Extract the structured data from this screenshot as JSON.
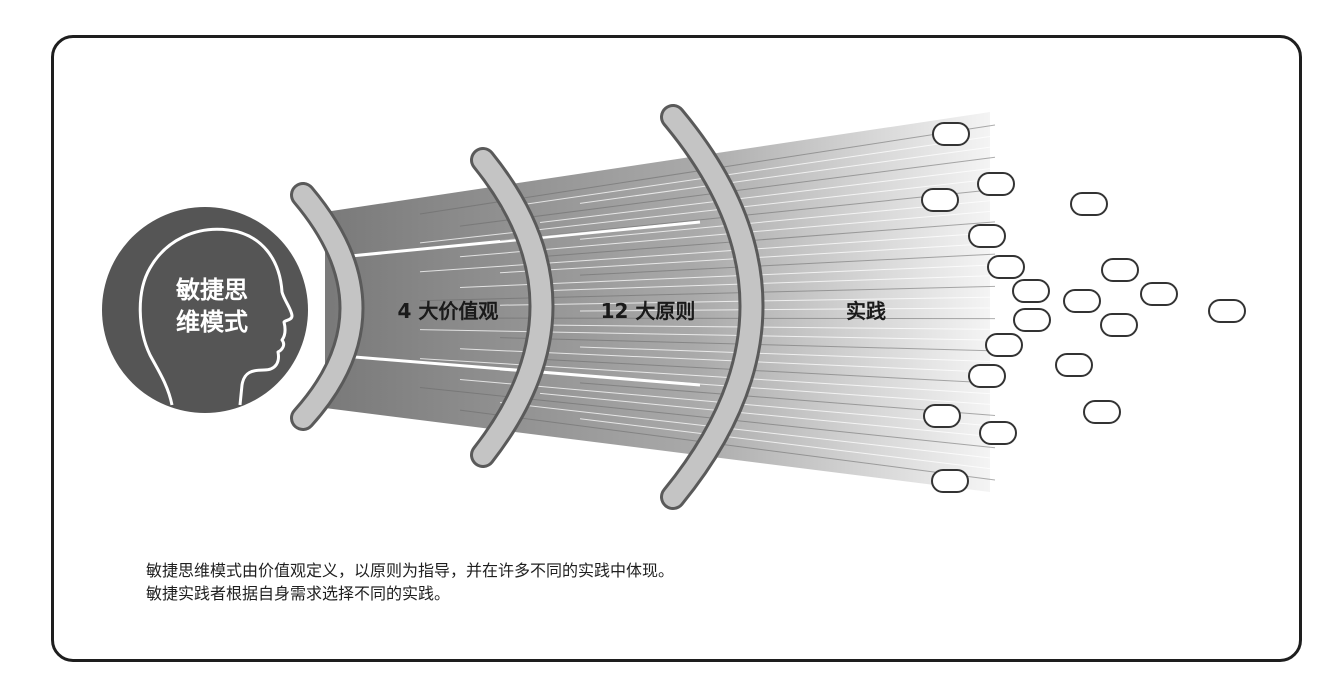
{
  "diagram": {
    "center_label_line1": "敏捷思",
    "center_label_line2": "维模式",
    "stage_values": "4 大价值观",
    "stage_principles": "12 大原则",
    "stage_practices": "实践"
  },
  "caption": {
    "line1": "敏捷思维模式由价值观定义，以原则为指导，并在许多不同的实践中体现。",
    "line2": "敏捷实践者根据自身需求选择不同的实践。"
  },
  "colors": {
    "head_circle": "#555555",
    "arc_fill": "#c4c4c4",
    "arc_stroke": "#5a5a5a",
    "beam_dark": "#7a7a7a",
    "frame": "#1e1e1e"
  }
}
